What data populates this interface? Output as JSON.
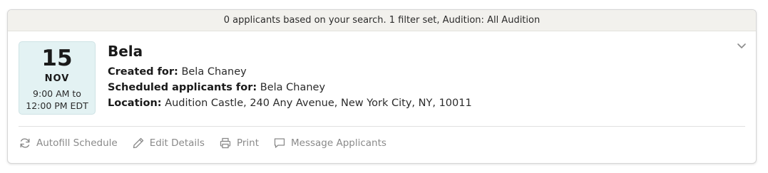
{
  "banner": {
    "text": "0 applicants based on your search. 1 filter set, Audition: All Audition"
  },
  "event": {
    "day": "15",
    "month": "NOV",
    "time_start": "9:00 AM to",
    "time_end": "12:00 PM EDT",
    "title": "Bela",
    "created_for_label": "Created for:",
    "created_for_value": "Bela Chaney",
    "scheduled_label": "Scheduled applicants for:",
    "scheduled_value": "Bela Chaney",
    "location_label": "Location:",
    "location_value": "Audition Castle, 240 Any Avenue, New York City, NY, 10011"
  },
  "actions": {
    "autofill": "Autofill Schedule",
    "edit": "Edit Details",
    "print": "Print",
    "message": "Message Applicants"
  },
  "icons": {
    "autofill": "refresh-icon",
    "edit": "pencil-icon",
    "print": "printer-icon",
    "message": "chat-bubble-icon",
    "expand": "chevron-down-icon"
  },
  "colors": {
    "banner_bg": "#f2f1ed",
    "date_bg": "#e3f2f3",
    "action_text": "#8a8a8a"
  }
}
